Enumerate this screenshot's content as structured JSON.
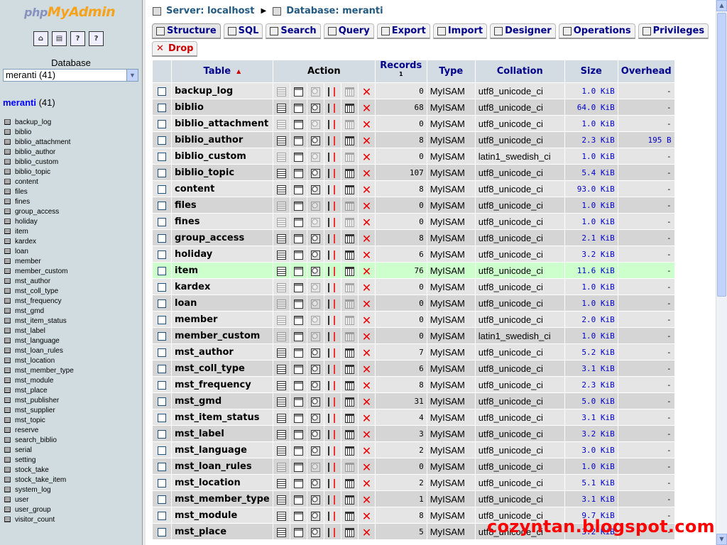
{
  "app": {
    "logo_php": "php",
    "logo_myadmin": "MyAdmin"
  },
  "left": {
    "database_label": "Database",
    "database_select_value": "meranti (41)",
    "db_name": "meranti",
    "db_count": "(41)",
    "tables": [
      "backup_log",
      "biblio",
      "biblio_attachment",
      "biblio_author",
      "biblio_custom",
      "biblio_topic",
      "content",
      "files",
      "fines",
      "group_access",
      "holiday",
      "item",
      "kardex",
      "loan",
      "member",
      "member_custom",
      "mst_author",
      "mst_coll_type",
      "mst_frequency",
      "mst_gmd",
      "mst_item_status",
      "mst_label",
      "mst_language",
      "mst_loan_rules",
      "mst_location",
      "mst_member_type",
      "mst_module",
      "mst_place",
      "mst_publisher",
      "mst_supplier",
      "mst_topic",
      "reserve",
      "search_biblio",
      "serial",
      "setting",
      "stock_take",
      "stock_take_item",
      "system_log",
      "user",
      "user_group",
      "visitor_count"
    ],
    "icons": [
      "home-icon",
      "sql-query-icon",
      "docs-icon",
      "help-icon"
    ]
  },
  "breadcrumb": {
    "server": "Server: localhost",
    "database": "Database: meranti"
  },
  "tabs": [
    {
      "label": "Structure",
      "icon": "structure-icon"
    },
    {
      "label": "SQL",
      "icon": "sql-icon"
    },
    {
      "label": "Search",
      "icon": "search-icon"
    },
    {
      "label": "Query",
      "icon": "query-icon"
    },
    {
      "label": "Export",
      "icon": "export-icon"
    },
    {
      "label": "Import",
      "icon": "import-icon"
    },
    {
      "label": "Designer",
      "icon": "designer-icon"
    },
    {
      "label": "Operations",
      "icon": "operations-icon"
    },
    {
      "label": "Privileges",
      "icon": "privileges-icon"
    },
    {
      "label": "Drop",
      "icon": "drop-icon"
    }
  ],
  "table": {
    "headers": {
      "table": "Table",
      "action": "Action",
      "records": "Records",
      "records_sup": "1",
      "type": "Type",
      "collation": "Collation",
      "size": "Size",
      "overhead": "Overhead"
    },
    "rows": [
      {
        "name": "backup_log",
        "records": "0",
        "type": "MyISAM",
        "collation": "utf8_unicode_ci",
        "size": "1.0 KiB",
        "overhead": "-"
      },
      {
        "name": "biblio",
        "records": "68",
        "type": "MyISAM",
        "collation": "utf8_unicode_ci",
        "size": "64.0 KiB",
        "overhead": "-"
      },
      {
        "name": "biblio_attachment",
        "records": "0",
        "type": "MyISAM",
        "collation": "utf8_unicode_ci",
        "size": "1.0 KiB",
        "overhead": "-"
      },
      {
        "name": "biblio_author",
        "records": "8",
        "type": "MyISAM",
        "collation": "utf8_unicode_ci",
        "size": "2.3 KiB",
        "overhead": "195 B"
      },
      {
        "name": "biblio_custom",
        "records": "0",
        "type": "MyISAM",
        "collation": "latin1_swedish_ci",
        "size": "1.0 KiB",
        "overhead": "-"
      },
      {
        "name": "biblio_topic",
        "records": "107",
        "type": "MyISAM",
        "collation": "utf8_unicode_ci",
        "size": "5.4 KiB",
        "overhead": "-"
      },
      {
        "name": "content",
        "records": "8",
        "type": "MyISAM",
        "collation": "utf8_unicode_ci",
        "size": "93.0 KiB",
        "overhead": "-"
      },
      {
        "name": "files",
        "records": "0",
        "type": "MyISAM",
        "collation": "utf8_unicode_ci",
        "size": "1.0 KiB",
        "overhead": "-"
      },
      {
        "name": "fines",
        "records": "0",
        "type": "MyISAM",
        "collation": "utf8_unicode_ci",
        "size": "1.0 KiB",
        "overhead": "-"
      },
      {
        "name": "group_access",
        "records": "8",
        "type": "MyISAM",
        "collation": "utf8_unicode_ci",
        "size": "2.1 KiB",
        "overhead": "-"
      },
      {
        "name": "holiday",
        "records": "6",
        "type": "MyISAM",
        "collation": "utf8_unicode_ci",
        "size": "3.2 KiB",
        "overhead": "-"
      },
      {
        "name": "item",
        "records": "76",
        "type": "MyISAM",
        "collation": "utf8_unicode_ci",
        "size": "11.6 KiB",
        "overhead": "-",
        "highlighted": true
      },
      {
        "name": "kardex",
        "records": "0",
        "type": "MyISAM",
        "collation": "utf8_unicode_ci",
        "size": "1.0 KiB",
        "overhead": "-"
      },
      {
        "name": "loan",
        "records": "0",
        "type": "MyISAM",
        "collation": "utf8_unicode_ci",
        "size": "1.0 KiB",
        "overhead": "-"
      },
      {
        "name": "member",
        "records": "0",
        "type": "MyISAM",
        "collation": "utf8_unicode_ci",
        "size": "2.0 KiB",
        "overhead": "-"
      },
      {
        "name": "member_custom",
        "records": "0",
        "type": "MyISAM",
        "collation": "latin1_swedish_ci",
        "size": "1.0 KiB",
        "overhead": "-"
      },
      {
        "name": "mst_author",
        "records": "7",
        "type": "MyISAM",
        "collation": "utf8_unicode_ci",
        "size": "5.2 KiB",
        "overhead": "-"
      },
      {
        "name": "mst_coll_type",
        "records": "6",
        "type": "MyISAM",
        "collation": "utf8_unicode_ci",
        "size": "3.1 KiB",
        "overhead": "-"
      },
      {
        "name": "mst_frequency",
        "records": "8",
        "type": "MyISAM",
        "collation": "utf8_unicode_ci",
        "size": "2.3 KiB",
        "overhead": "-"
      },
      {
        "name": "mst_gmd",
        "records": "31",
        "type": "MyISAM",
        "collation": "utf8_unicode_ci",
        "size": "5.0 KiB",
        "overhead": "-"
      },
      {
        "name": "mst_item_status",
        "records": "4",
        "type": "MyISAM",
        "collation": "utf8_unicode_ci",
        "size": "3.1 KiB",
        "overhead": "-"
      },
      {
        "name": "mst_label",
        "records": "3",
        "type": "MyISAM",
        "collation": "utf8_unicode_ci",
        "size": "3.2 KiB",
        "overhead": "-"
      },
      {
        "name": "mst_language",
        "records": "2",
        "type": "MyISAM",
        "collation": "utf8_unicode_ci",
        "size": "3.0 KiB",
        "overhead": "-"
      },
      {
        "name": "mst_loan_rules",
        "records": "0",
        "type": "MyISAM",
        "collation": "utf8_unicode_ci",
        "size": "1.0 KiB",
        "overhead": "-"
      },
      {
        "name": "mst_location",
        "records": "2",
        "type": "MyISAM",
        "collation": "utf8_unicode_ci",
        "size": "5.1 KiB",
        "overhead": "-"
      },
      {
        "name": "mst_member_type",
        "records": "1",
        "type": "MyISAM",
        "collation": "utf8_unicode_ci",
        "size": "3.1 KiB",
        "overhead": "-"
      },
      {
        "name": "mst_module",
        "records": "8",
        "type": "MyISAM",
        "collation": "utf8_unicode_ci",
        "size": "9.7 KiB",
        "overhead": "-"
      },
      {
        "name": "mst_place",
        "records": "5",
        "type": "MyISAM",
        "collation": "utf8_unicode_ci",
        "size": "3.2 KiB",
        "overhead": "-"
      }
    ]
  },
  "watermark": "cozyntan.blogspot.com",
  "colors": {
    "left_bg": "#d0dce0",
    "header_bg": "#d3dce3",
    "row_odd": "#e5e5e5",
    "row_even": "#d5d5d5",
    "row_highlight": "#ccffcc",
    "link": "#00008b",
    "drop": "#ff0000"
  }
}
